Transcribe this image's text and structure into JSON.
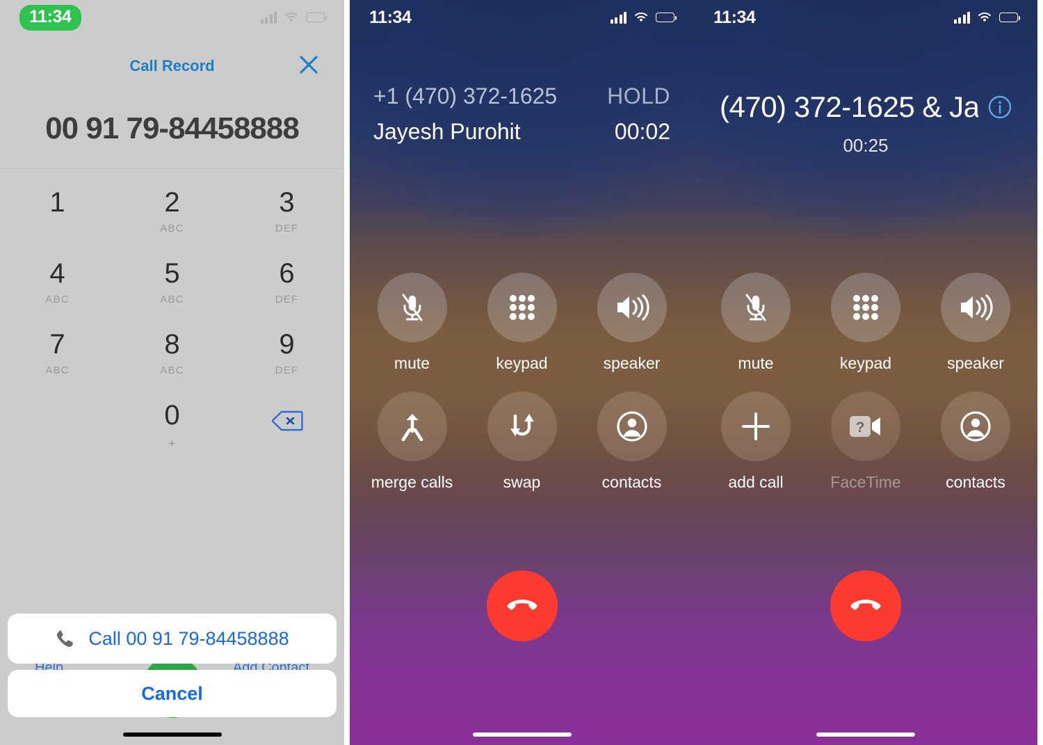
{
  "panels": {
    "dialer": {
      "status": {
        "time": "11:34",
        "icons": [
          "cellular-icon",
          "wifi-icon",
          "battery-icon"
        ]
      },
      "title": "Call Record",
      "close_label": "close-icon",
      "number": "00 91 79-84458888",
      "keys": [
        {
          "digit": "1",
          "sub": ""
        },
        {
          "digit": "2",
          "sub": "ABC"
        },
        {
          "digit": "3",
          "sub": "DEF"
        },
        {
          "digit": "4",
          "sub": "ABC"
        },
        {
          "digit": "5",
          "sub": "ABC"
        },
        {
          "digit": "6",
          "sub": "DEF"
        },
        {
          "digit": "7",
          "sub": "ABC"
        },
        {
          "digit": "8",
          "sub": "ABC"
        },
        {
          "digit": "9",
          "sub": "DEF"
        },
        {
          "digit": "0",
          "sub": "+"
        }
      ],
      "backspace_label": "backspace-icon",
      "call_action": "Call 00 91 79-84458888",
      "cancel_action": "Cancel",
      "help_link": "Help",
      "add_contact_link": "Add Contact"
    },
    "incall_hold": {
      "status": {
        "time": "11:34"
      },
      "number": "+1 (470) 372-1625",
      "state": "HOLD",
      "name": "Jayesh Purohit",
      "timer": "00:02",
      "actions": [
        {
          "label": "mute",
          "icon": "mic-off-icon",
          "disabled": false
        },
        {
          "label": "keypad",
          "icon": "keypad-icon",
          "disabled": false
        },
        {
          "label": "speaker",
          "icon": "speaker-icon",
          "disabled": false
        },
        {
          "label": "merge calls",
          "icon": "merge-calls-icon",
          "disabled": false
        },
        {
          "label": "swap",
          "icon": "swap-icon",
          "disabled": false
        },
        {
          "label": "contacts",
          "icon": "contacts-icon",
          "disabled": false
        }
      ],
      "end_call_label": "end-call-icon"
    },
    "incall_merged": {
      "status": {
        "time": "11:34"
      },
      "title": "(470) 372-1625 & Ja",
      "info_label": "info-icon",
      "timer": "00:25",
      "actions": [
        {
          "label": "mute",
          "icon": "mic-off-icon",
          "disabled": false
        },
        {
          "label": "keypad",
          "icon": "keypad-icon",
          "disabled": false
        },
        {
          "label": "speaker",
          "icon": "speaker-icon",
          "disabled": false
        },
        {
          "label": "add call",
          "icon": "add-call-icon",
          "disabled": false
        },
        {
          "label": "FaceTime",
          "icon": "facetime-unavailable-icon",
          "disabled": true
        },
        {
          "label": "contacts",
          "icon": "contacts-icon",
          "disabled": false
        }
      ],
      "end_call_label": "end-call-icon"
    }
  },
  "colors": {
    "accent_blue": "#1668e3",
    "title_blue": "#1b7fc4",
    "status_green": "#2fc24f",
    "end_call_red": "#fc3b30",
    "call_green": "#2aa548",
    "dialer_bg": "#cccccc"
  }
}
